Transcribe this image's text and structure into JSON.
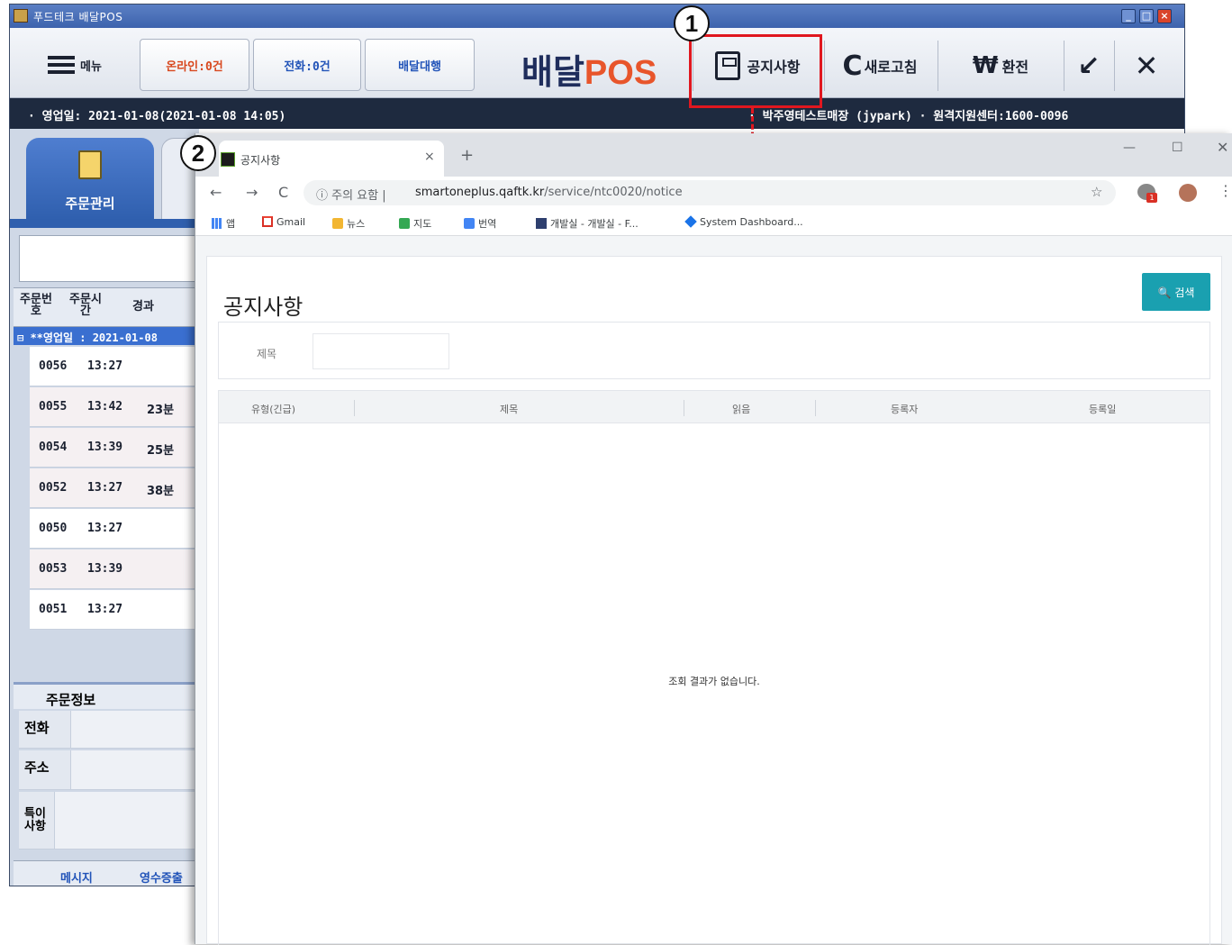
{
  "pos": {
    "title": "푸드테크 배달POS",
    "toolbar": {
      "menu": "메뉴",
      "online": "온라인:0건",
      "phone": "전화:0건",
      "delivery": "배달대행",
      "brand_a": "배달",
      "brand_b": "POS",
      "notice": "공지사항",
      "refresh": "새로고침",
      "change": "환전",
      "refresh_icon": "C",
      "won_icon": "₩",
      "minimize_icon": "↙",
      "close_icon": "✕"
    },
    "info_bar": {
      "business_date": "· 영업일: 2021-01-08(2021-01-08 14:05)",
      "store": "· 박주영테스트매장 (jypark)  · 원격지원센터:1600-0096"
    },
    "left": {
      "tab_orders": "주문관리",
      "headers": [
        "주문번호",
        "주문시간",
        "경과"
      ],
      "group": "⊟ **영업일 : 2021-01-08",
      "rows": [
        {
          "no": "0056",
          "time": "13:27",
          "elapsed": ""
        },
        {
          "no": "0055",
          "time": "13:42",
          "elapsed": "23분"
        },
        {
          "no": "0054",
          "time": "13:39",
          "elapsed": "25분"
        },
        {
          "no": "0052",
          "time": "13:27",
          "elapsed": "38분"
        },
        {
          "no": "0050",
          "time": "13:27",
          "elapsed": ""
        },
        {
          "no": "0053",
          "time": "13:39",
          "elapsed": ""
        },
        {
          "no": "0051",
          "time": "13:27",
          "elapsed": ""
        }
      ],
      "order_info": "주문정보",
      "info_labels": [
        "전화",
        "주소",
        "특이사항"
      ],
      "bottom": [
        "메시지",
        "영수증출"
      ]
    }
  },
  "annotations": {
    "marker1": "1",
    "marker2": "2"
  },
  "browser": {
    "tab_title": "공지사항",
    "tab_close": "×",
    "new_tab": "+",
    "win_min": "—",
    "win_max": "☐",
    "win_close": "✕",
    "security": "ⓘ 주의 요함 |",
    "url_host": "smartoneplus.qaftk.kr",
    "url_path": "/service/ntc0020/notice",
    "nav_back": "←",
    "nav_forward": "→",
    "nav_reload": "C",
    "star": "☆",
    "ext_badge": "1",
    "kebab": "⋮",
    "bookmarks": [
      "앱",
      "Gmail",
      "뉴스",
      "지도",
      "번역",
      "개발실 - 개발실 - F...",
      "System Dashboard..."
    ]
  },
  "page": {
    "title": "공지사항",
    "search_button": "🔍 검색",
    "filter_label": "제목",
    "columns": [
      "유형(긴급)",
      "제목",
      "읽음",
      "등록자",
      "등록일"
    ],
    "empty_message": "조회 결과가 없습니다."
  },
  "colors": {
    "accent": "#1aa0b0",
    "highlight": "#e0171f",
    "pos_dark": "#1e2a3f",
    "pos_blue": "#2f5fae"
  }
}
